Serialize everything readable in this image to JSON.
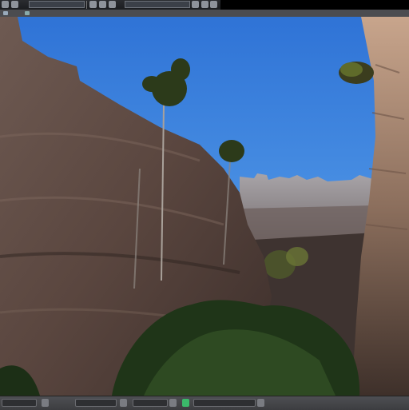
{
  "window": {
    "title": ""
  },
  "toolbar": {
    "icons": [
      "menu-icon",
      "render-icon",
      "camera-icon",
      "settings-icon",
      "view-icon",
      "overlay-icon"
    ]
  },
  "viewport": {
    "content": "rendered-canyon-scene"
  },
  "statusbar": {
    "icons": [
      "view-menu-icon",
      "mode-icon",
      "layer-icon",
      "snap-icon",
      "render-toggle-icon"
    ]
  },
  "colors": {
    "toolbar_bg": "#1b1d20",
    "statusbar_bg": "#3c3d40",
    "accent_green": "#3bb86a",
    "sky": "#3b7ed8"
  }
}
